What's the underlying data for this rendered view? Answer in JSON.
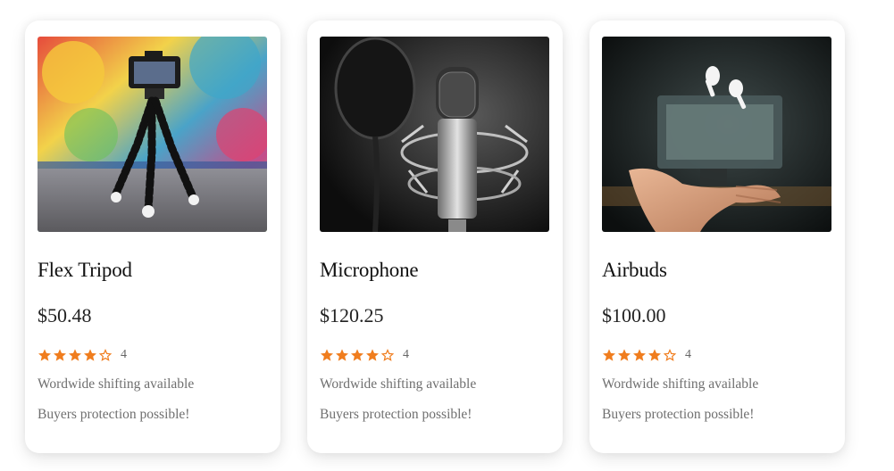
{
  "products": [
    {
      "image_alt": "flex tripod with camera",
      "title": "Flex Tripod",
      "price": "$50.48",
      "rating": 4,
      "rating_label": "4",
      "shipping": "Wordwide shifting available",
      "protection": "Buyers protection possible!"
    },
    {
      "image_alt": "studio microphone",
      "title": "Microphone",
      "price": "$120.25",
      "rating": 4,
      "rating_label": "4",
      "shipping": "Wordwide shifting available",
      "protection": "Buyers protection possible!"
    },
    {
      "image_alt": "airbuds floating above hand",
      "title": "Airbuds",
      "price": "$100.00",
      "rating": 4,
      "rating_label": "4",
      "shipping": "Wordwide shifting available",
      "protection": "Buyers protection possible!"
    }
  ],
  "colors": {
    "star": "#f07d1e",
    "title": "#111111",
    "muted": "#6f6f6f"
  }
}
